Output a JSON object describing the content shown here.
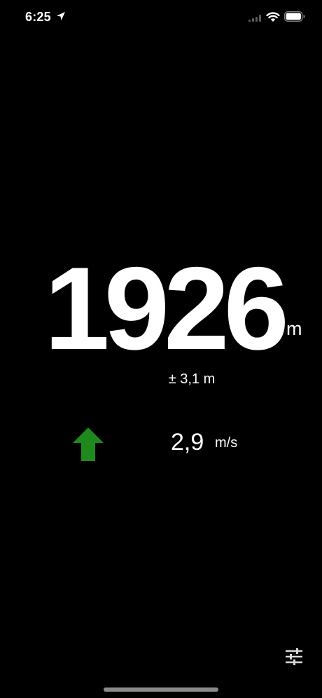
{
  "status_bar": {
    "time": "6:25",
    "icons": [
      "location-arrow-icon",
      "cellular-signal-icon",
      "wifi-icon",
      "battery-icon"
    ]
  },
  "altitude": {
    "value": "1926",
    "unit": "m",
    "accuracy": "± 3,1 m"
  },
  "vertical_speed": {
    "trend_icon": "arrow-up-icon",
    "value": "2,9",
    "unit": "m/s"
  },
  "settings": {
    "icon": "sliders-icon"
  },
  "colors": {
    "background": "#000000",
    "text": "#ffffff",
    "trend_up": "#1e8a1e",
    "muted": "#8a8a8a"
  }
}
